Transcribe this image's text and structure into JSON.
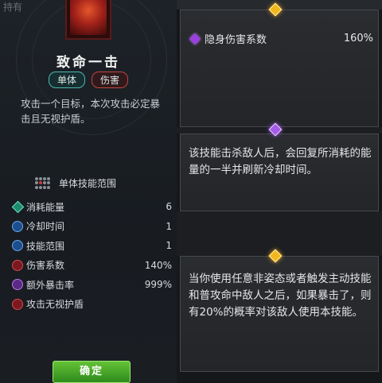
{
  "left": {
    "top_clip_text": "持有",
    "skill_name": "致命一击",
    "tags": [
      "单体",
      "伤害"
    ],
    "description": "攻击一个目标，本次攻击必定暴击且无视护盾。",
    "range_label": "单体技能范围",
    "stats": [
      {
        "icon": "energy-diamond-icon",
        "label": "消耗能量",
        "value": "6"
      },
      {
        "icon": "cooldown-icon",
        "label": "冷却时间",
        "value": "1"
      },
      {
        "icon": "skill-range-icon",
        "label": "技能范围",
        "value": "1"
      },
      {
        "icon": "damage-coefficient-icon",
        "label": "伤害系数",
        "value": "140%"
      },
      {
        "icon": "extra-crit-icon",
        "label": "额外暴击率",
        "value": "999%"
      },
      {
        "icon": "ignore-shield-icon",
        "label": "攻击无视护盾",
        "value": ""
      }
    ],
    "confirm_label": "确定"
  },
  "right": {
    "tip1": {
      "icon": "stealth-icon",
      "label": "隐身伤害系数",
      "value": "160%"
    },
    "tip2": {
      "text": "该技能击杀敌人后，会回复所消耗的能量的一半并刷新冷却时间。"
    },
    "tip3": {
      "text": "当你使用任意非姿态或者触发主动技能和普攻命中敌人之后，如果暴击了，则有20%的概率对该敌人使用本技能。"
    }
  },
  "colors": {
    "confirm_green": "#2e8a1b",
    "tag_teal": "#4bb7b0",
    "tag_red": "#c0453f",
    "gem_gold": "#f2b71e",
    "gem_purple": "#a55ce8"
  }
}
